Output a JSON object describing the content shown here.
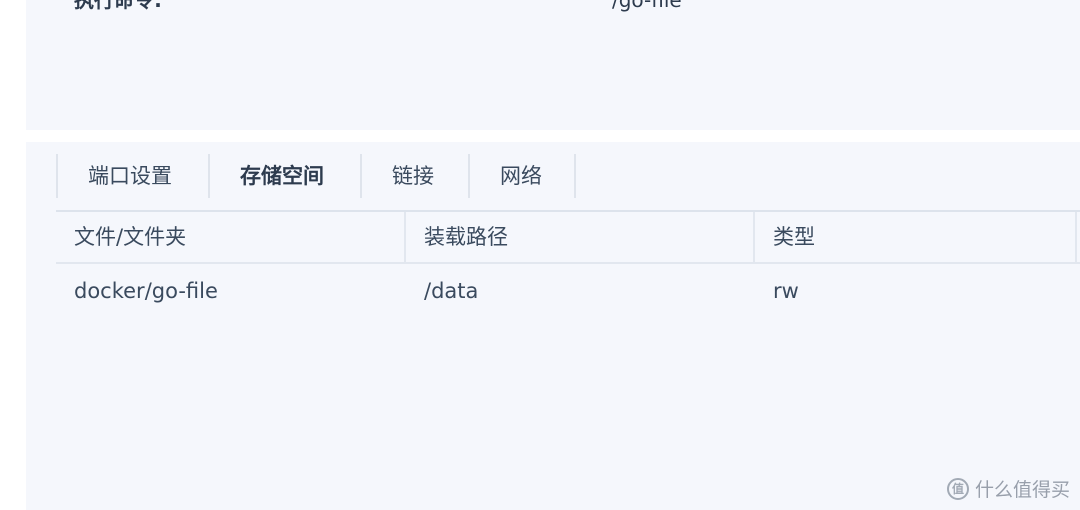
{
  "command": {
    "label": "执行命令:",
    "value": "/go-file"
  },
  "tabs": [
    {
      "label": "端口设置",
      "active": false
    },
    {
      "label": "存储空间",
      "active": true
    },
    {
      "label": "链接",
      "active": false
    },
    {
      "label": "网络",
      "active": false
    }
  ],
  "table": {
    "headers": [
      "文件/文件夹",
      "装载路径",
      "类型"
    ],
    "rows": [
      [
        "docker/go-file",
        "/data",
        "rw"
      ]
    ]
  },
  "watermark": {
    "logo_text": "值",
    "text": "什么值得买"
  }
}
